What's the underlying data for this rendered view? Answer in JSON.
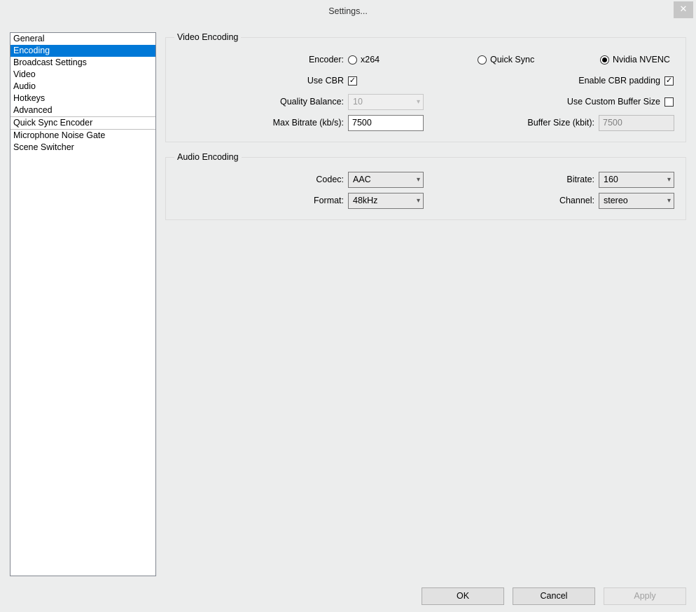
{
  "window": {
    "title": "Settings..."
  },
  "sidebar": {
    "sections": [
      [
        "General",
        "Encoding",
        "Broadcast Settings",
        "Video",
        "Audio",
        "Hotkeys",
        "Advanced"
      ],
      [
        "Quick Sync Encoder"
      ],
      [
        "Microphone Noise Gate",
        "Scene Switcher"
      ]
    ],
    "selected": "Encoding"
  },
  "video_encoding": {
    "legend": "Video Encoding",
    "encoder_label": "Encoder:",
    "encoder_options": {
      "x264": "x264",
      "quicksync": "Quick Sync",
      "nvenc": "Nvidia NVENC"
    },
    "encoder_selected": "nvenc",
    "use_cbr_label": "Use CBR",
    "use_cbr_checked": true,
    "enable_cbr_padding_label": "Enable CBR padding",
    "enable_cbr_padding_checked": true,
    "quality_balance_label": "Quality Balance:",
    "quality_balance_value": "10",
    "quality_balance_enabled": false,
    "use_custom_buffer_label": "Use Custom Buffer Size",
    "use_custom_buffer_checked": false,
    "max_bitrate_label": "Max Bitrate (kb/s):",
    "max_bitrate_value": "7500",
    "buffer_size_label": "Buffer Size (kbit):",
    "buffer_size_value": "7500",
    "buffer_size_enabled": false
  },
  "audio_encoding": {
    "legend": "Audio Encoding",
    "codec_label": "Codec:",
    "codec_value": "AAC",
    "bitrate_label": "Bitrate:",
    "bitrate_value": "160",
    "format_label": "Format:",
    "format_value": "48kHz",
    "channel_label": "Channel:",
    "channel_value": "stereo"
  },
  "buttons": {
    "ok": "OK",
    "cancel": "Cancel",
    "apply": "Apply"
  }
}
